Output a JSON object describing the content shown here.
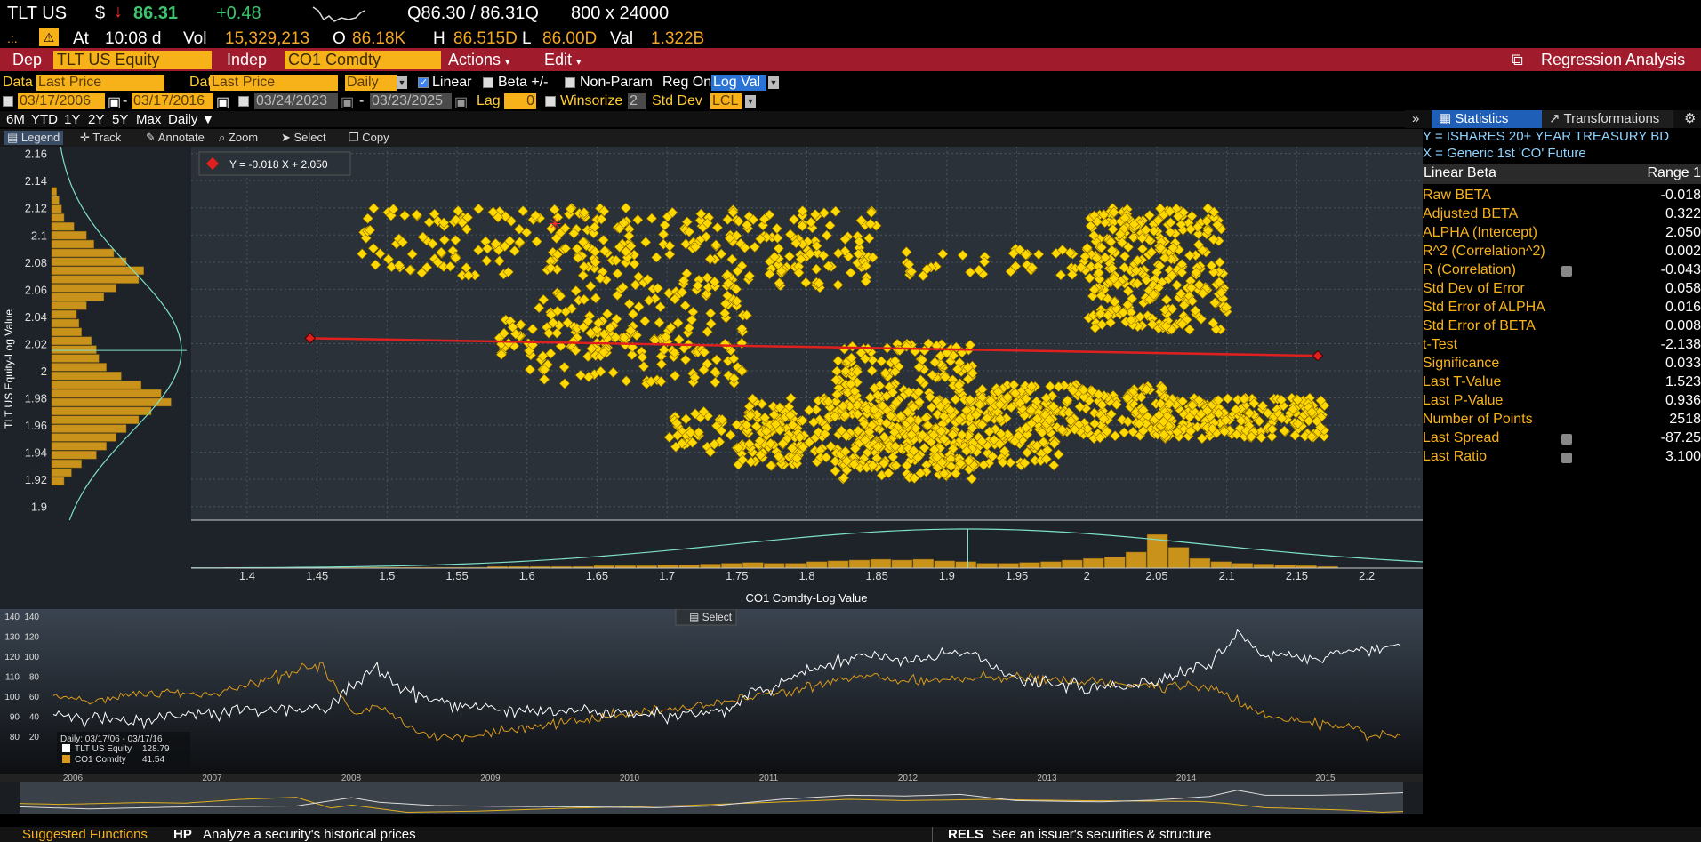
{
  "quote": {
    "ticker": "TLT US",
    "currency": "$",
    "last_price": "86.31",
    "change": "+0.48",
    "bid_ask": "Q86.30 / 86.31Q",
    "size": "800 x 24000",
    "at_label": "At",
    "time": "10:08 d",
    "vol_label": "Vol",
    "volume": "15,329,213",
    "o_label": "O",
    "open": "86.18K",
    "h_label": "H",
    "high": "86.515D",
    "l_label": "L",
    "low": "86.00D",
    "val_label": "Val",
    "value": "1.322B"
  },
  "function_bar": {
    "dep_label": "Dep",
    "dep_value": "TLT US Equity",
    "indep_label": "Indep",
    "indep_value": "CO1 Comdty",
    "actions_label": "Actions",
    "edit_label": "Edit",
    "title": "Regression Analysis"
  },
  "params": {
    "data_label": "Data",
    "data1": "Last Price",
    "data2": "Last Price",
    "frequency": "Daily",
    "linear_label": "Linear",
    "beta_label": "Beta +/-",
    "nonparam_label": "Non-Param",
    "regon_label": "Reg On",
    "regon_value": "Log Val",
    "start1": "03/17/2006",
    "end1": "03/17/2016",
    "start2": "03/24/2023",
    "end2": "03/23/2025",
    "lag_label": "Lag",
    "lag_value": "0",
    "winsorize_label": "Winsorize",
    "winsorize_value": "2",
    "stddev_label": "Std Dev",
    "stddev_value": "LCL"
  },
  "range_buttons": [
    "6M",
    "YTD",
    "1Y",
    "2Y",
    "5Y",
    "Max",
    "Daily ▼"
  ],
  "chart_toolbar": [
    "Legend",
    "Track",
    "Annotate",
    "Zoom",
    "Select",
    "Copy"
  ],
  "right_tabs": {
    "statistics": "Statistics",
    "transformations": "Transformations"
  },
  "stats": {
    "y_desc": "Y = ISHARES 20+ YEAR TREASURY BD",
    "x_desc": "X = Generic 1st 'CO' Future",
    "col1": "Linear Beta",
    "col2": "Range 1",
    "rows": [
      {
        "k": "Raw BETA",
        "v": "-0.018"
      },
      {
        "k": "Adjusted BETA",
        "v": "0.322"
      },
      {
        "k": "ALPHA (Intercept)",
        "v": "2.050"
      },
      {
        "k": "R^2 (Correlation^2)",
        "v": "0.002"
      },
      {
        "k": "R (Correlation)",
        "v": "-0.043"
      },
      {
        "k": "Std Dev of Error",
        "v": "0.058"
      },
      {
        "k": "Std Error of ALPHA",
        "v": "0.016"
      },
      {
        "k": "Std Error of BETA",
        "v": "0.008"
      },
      {
        "k": "t-Test",
        "v": "-2.138"
      },
      {
        "k": "Significance",
        "v": "0.033"
      },
      {
        "k": "Last T-Value",
        "v": "1.523"
      },
      {
        "k": "Last P-Value",
        "v": "0.936"
      },
      {
        "k": "Number of Points",
        "v": "2518"
      },
      {
        "k": "Last Spread",
        "v": "-87.25"
      },
      {
        "k": "Last Ratio",
        "v": "3.100"
      }
    ]
  },
  "chart_data": [
    {
      "type": "scatter",
      "legend": "Y = -0.018 X + 2.050",
      "xlabel": "CO1 Comdty-Log Value",
      "ylabel": "TLT US Equity-Log Value",
      "xlim": [
        1.36,
        2.24
      ],
      "ylim": [
        1.89,
        2.165
      ],
      "xticks": [
        "1.4",
        "1.45",
        "1.5",
        "1.55",
        "1.6",
        "1.65",
        "1.7",
        "1.75",
        "1.8",
        "1.85",
        "1.9",
        "1.95",
        "2",
        "2.05",
        "2.1",
        "2.15",
        "2.2"
      ],
      "yticks": [
        "2.16",
        "2.14",
        "2.12",
        "2.1",
        "2.08",
        "2.06",
        "2.04",
        "2.02",
        "2",
        "1.98",
        "1.96",
        "1.94",
        "1.92",
        "1.9"
      ],
      "regression": {
        "slope": -0.018,
        "intercept": 2.05,
        "x_start": 1.445,
        "x_end": 2.165
      },
      "clusters": [
        {
          "x": [
            1.48,
            1.72
          ],
          "y": [
            2.07,
            2.12
          ],
          "n": 180
        },
        {
          "x": [
            1.6,
            1.76
          ],
          "y": [
            1.99,
            2.07
          ],
          "n": 160
        },
        {
          "x": [
            1.58,
            1.72
          ],
          "y": [
            2.01,
            2.04
          ],
          "n": 60
        },
        {
          "x": [
            1.72,
            1.85
          ],
          "y": [
            2.06,
            2.12
          ],
          "n": 140
        },
        {
          "x": [
            1.75,
            1.98
          ],
          "y": [
            1.93,
            1.98
          ],
          "n": 380
        },
        {
          "x": [
            1.82,
            1.92
          ],
          "y": [
            1.92,
            2.02
          ],
          "n": 260
        },
        {
          "x": [
            1.92,
            2.06
          ],
          "y": [
            1.95,
            1.99
          ],
          "n": 200
        },
        {
          "x": [
            2.0,
            2.1
          ],
          "y": [
            2.03,
            2.12
          ],
          "n": 300
        },
        {
          "x": [
            2.05,
            2.17
          ],
          "y": [
            1.95,
            1.98
          ],
          "n": 200
        },
        {
          "x": [
            1.7,
            1.8
          ],
          "y": [
            1.94,
            1.97
          ],
          "n": 60
        },
        {
          "x": [
            1.87,
            2.0
          ],
          "y": [
            2.07,
            2.09
          ],
          "n": 40
        }
      ]
    },
    {
      "type": "line",
      "legend_date": "Daily: 03/17/06 - 03/17/16",
      "series": [
        {
          "name": "TLT US Equity",
          "last": "128.79"
        },
        {
          "name": "CO1 Comdty",
          "last": "41.54"
        }
      ],
      "x_years": [
        "2006",
        "2007",
        "2008",
        "2009",
        "2010",
        "2011",
        "2012",
        "2013",
        "2014",
        "2015",
        "2016"
      ],
      "left_axis": [
        "140",
        "130",
        "120",
        "110",
        "100",
        "90",
        "80"
      ],
      "right_axis": [
        "140",
        "120",
        "100",
        "80",
        "60",
        "40",
        "20"
      ]
    }
  ],
  "footer": {
    "suggested": "Suggested Functions",
    "hp_code": "HP",
    "hp_desc": "Analyze a security's historical prices",
    "rels_code": "RELS",
    "rels_desc": "See an issuer's securities & structure"
  },
  "select_button": "Select",
  "colors": {
    "accent_bar": "#a01b2b",
    "amber": "#f7b21a",
    "scatter": "#ffd800",
    "regression": "#e0201f",
    "tlt_line": "#ffffff",
    "co1_line": "#d99a1a"
  }
}
